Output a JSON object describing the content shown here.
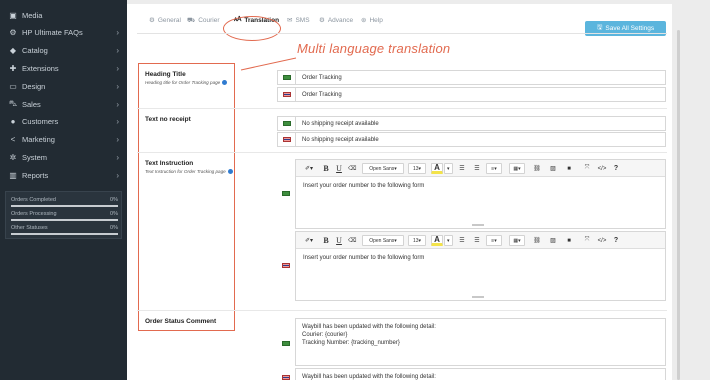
{
  "sidebar": {
    "items": [
      {
        "label": "Media",
        "icon": "image-icon",
        "chevron": false
      },
      {
        "label": "HP Ultimate FAQs",
        "icon": "cogs-icon",
        "chevron": true
      },
      {
        "label": "Catalog",
        "icon": "tag-icon",
        "chevron": true
      },
      {
        "label": "Extensions",
        "icon": "puzzle-icon",
        "chevron": true
      },
      {
        "label": "Design",
        "icon": "monitor-icon",
        "chevron": true
      },
      {
        "label": "Sales",
        "icon": "cart-icon",
        "chevron": true
      },
      {
        "label": "Customers",
        "icon": "user-icon",
        "chevron": true
      },
      {
        "label": "Marketing",
        "icon": "share-icon",
        "chevron": true
      },
      {
        "label": "System",
        "icon": "gear-icon",
        "chevron": true
      },
      {
        "label": "Reports",
        "icon": "bar-chart-icon",
        "chevron": true
      }
    ],
    "stats": [
      {
        "label": "Orders Completed",
        "value": "0%"
      },
      {
        "label": "Orders Processing",
        "value": "0%"
      },
      {
        "label": "Other Statuses",
        "value": "0%"
      }
    ]
  },
  "tabs": [
    {
      "label": "General",
      "icon": "gear-icon"
    },
    {
      "label": "Courier",
      "icon": "truck-icon"
    },
    {
      "label": "Translation",
      "icon": "language-icon"
    },
    {
      "label": "SMS",
      "icon": "sms-icon"
    },
    {
      "label": "Advance",
      "icon": "cogs-icon"
    },
    {
      "label": "Help",
      "icon": "help-icon"
    }
  ],
  "save_button": {
    "label": "Save All Settings",
    "icon": "save-icon"
  },
  "annotation": "Multi language translation",
  "colors": {
    "annotation": "#e26a4f",
    "sidebar_bg": "#222b33",
    "save_button": "#5bb5dd"
  },
  "sections": {
    "heading_title": {
      "label": "Heading Title",
      "help": "Heading title for Order Tracking page",
      "en": "Order Tracking",
      "th": "Order Tracking"
    },
    "text_no_receipt": {
      "label": "Text no receipt",
      "en": "No shipping receipt available",
      "th": "No shipping receipt available"
    },
    "text_instruction": {
      "label": "Text Instruction",
      "help": "Text Instruction for Order Tracking page",
      "en": "Insert your order number to the following form",
      "th": "Insert your order number to the following form"
    },
    "order_status_comment": {
      "label": "Order Status Comment",
      "en": "Waybill has been updated with the following detail:\nCourier: {courier}\nTracking Number: {tracking_number}",
      "th": "Waybill has been updated with the following detail:\nCourier: {courier}"
    }
  },
  "editor_toolbar": {
    "font": "Open Sans",
    "size": "13",
    "help": "?"
  }
}
